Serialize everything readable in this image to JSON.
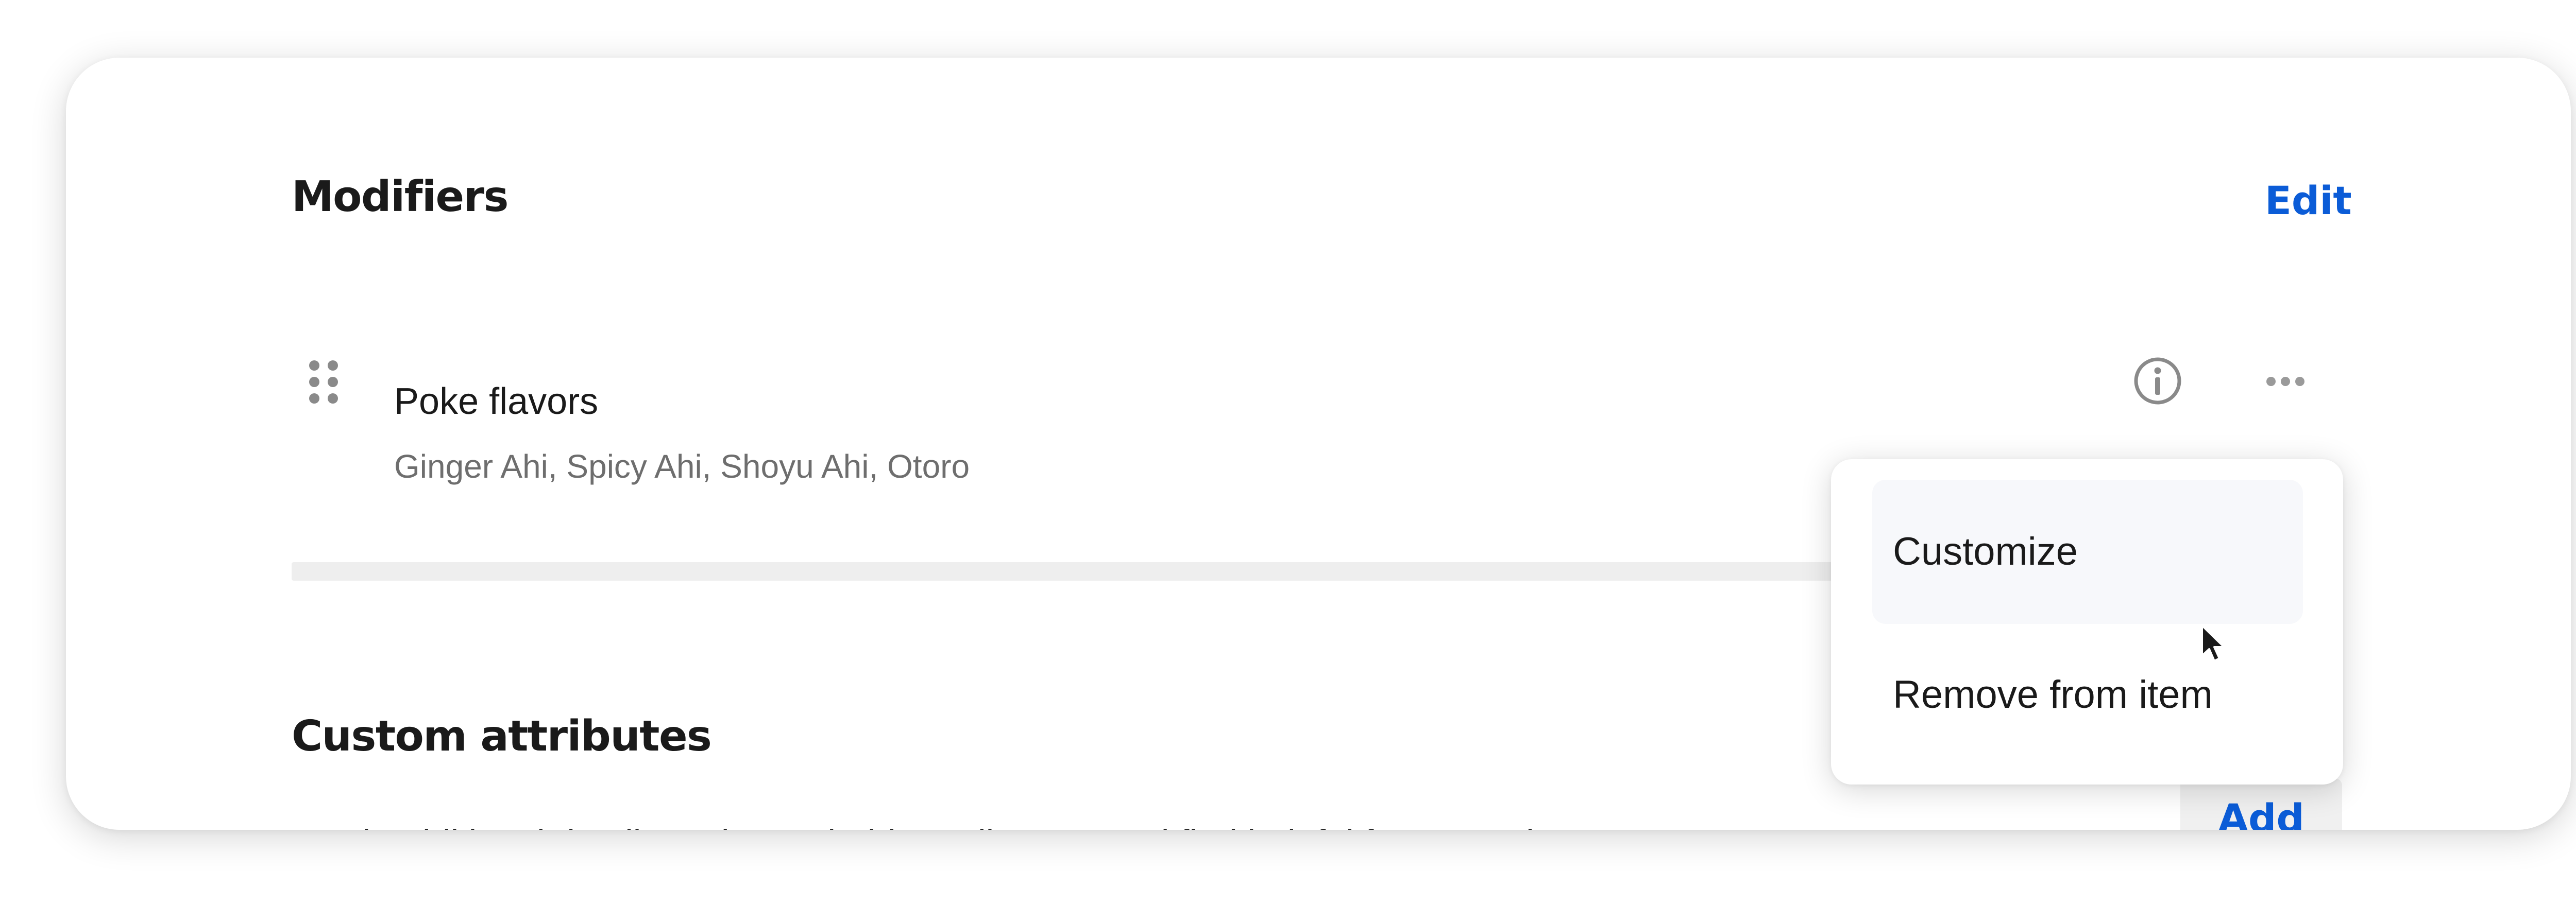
{
  "modifiers": {
    "title": "Modifiers",
    "edit_label": "Edit",
    "row": {
      "title": "Poke flavors",
      "subtitle": "Ginger Ahi, Spicy Ahi, Shoyu Ahi, Otoro",
      "info_icon": "info-icon",
      "more_icon": "more-horizontal-icon",
      "drag_icon": "drag-handle-icon"
    }
  },
  "context_menu": {
    "items": [
      {
        "label": "Customize",
        "hovered": true
      },
      {
        "label": "Remove from item",
        "hovered": false
      }
    ]
  },
  "custom_attributes": {
    "title": "Custom attributes",
    "add_label": "Add",
    "description_partial": "Track additional details and searchable attributes you'd find helpful for managing"
  },
  "colors": {
    "accent": "#0b5cd7",
    "text_primary": "#1a1a1a",
    "text_secondary": "#6e6e6e",
    "icon": "#8a8a8a"
  }
}
